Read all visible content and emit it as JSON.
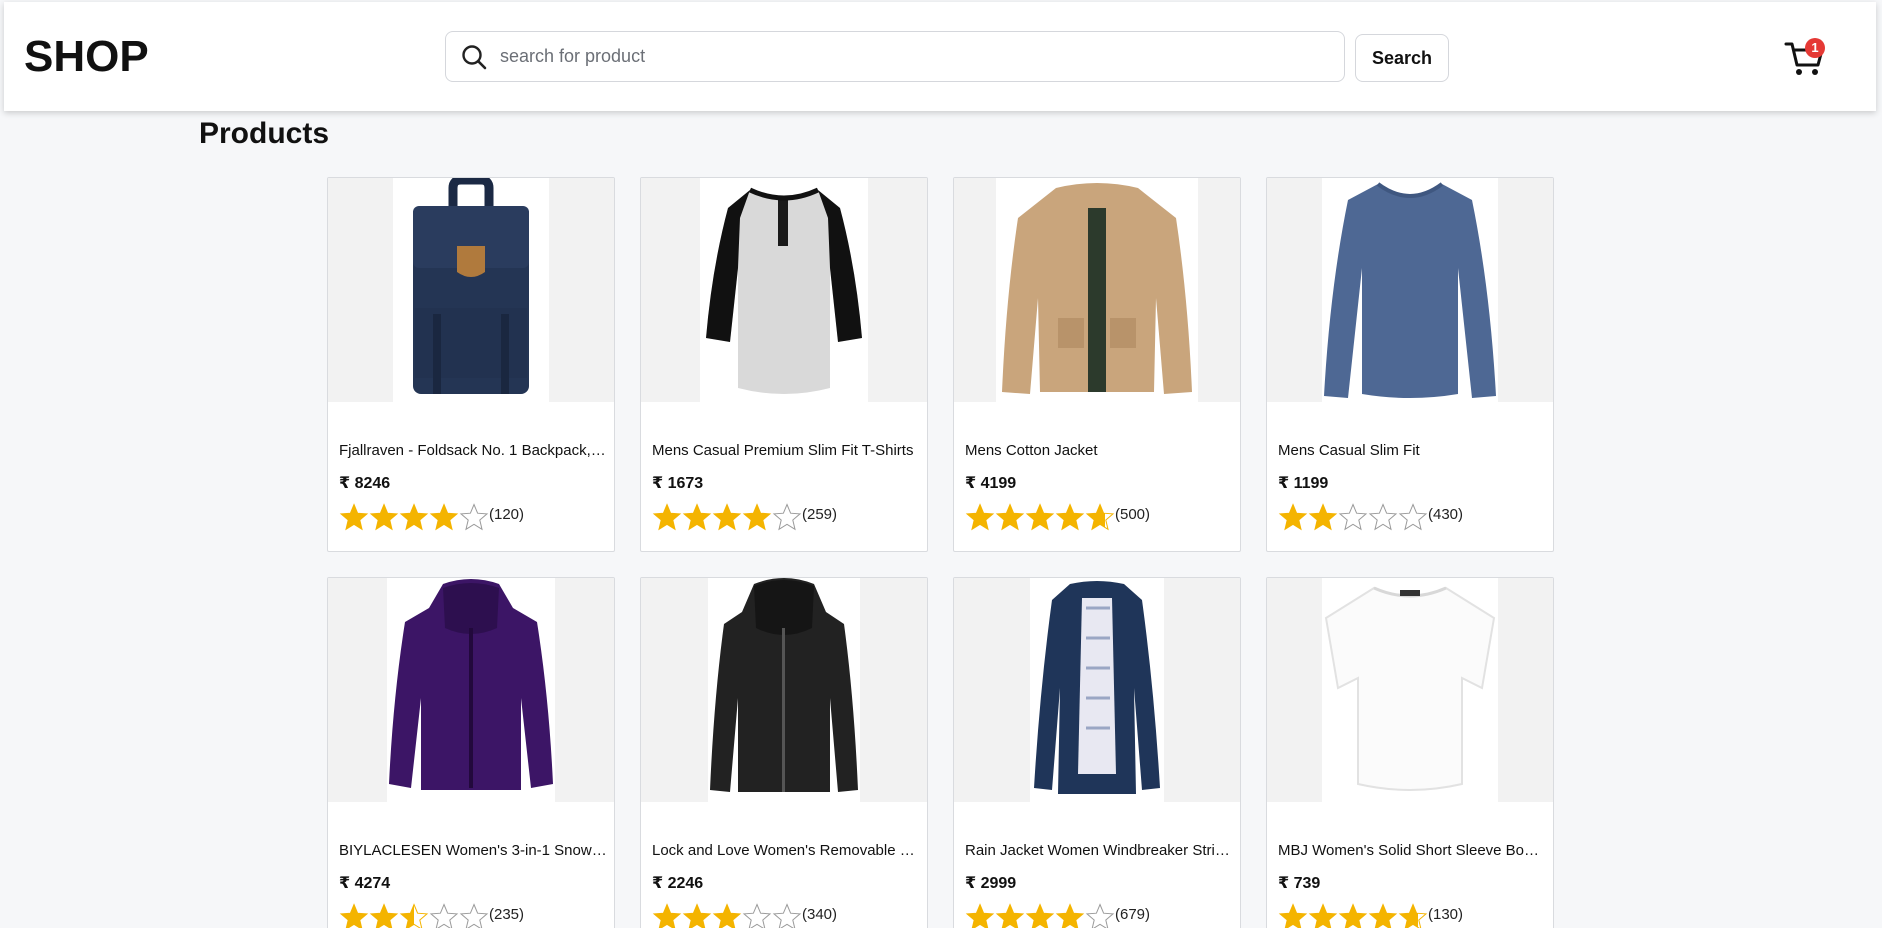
{
  "header": {
    "brand": "SHOP",
    "search": {
      "placeholder": "search for product",
      "value": "",
      "icon": "search-icon"
    },
    "search_button": "Search",
    "cart": {
      "icon": "cart-icon",
      "count": "1"
    }
  },
  "page": {
    "title": "Products"
  },
  "colors": {
    "star_filled": "#f4b400",
    "star_empty_stroke": "#9a9a9a",
    "badge": "#e53935"
  },
  "products": [
    {
      "name": "Fjallraven - Foldsack No. 1 Backpack, F...",
      "price": "₹ 8246",
      "rating": 4,
      "count": "(120)",
      "image": "backpack"
    },
    {
      "name": "Mens Casual Premium Slim Fit T-Shirts",
      "price": "₹ 1673",
      "rating": 4,
      "count": "(259)",
      "image": "raglan-tshirt"
    },
    {
      "name": "Mens Cotton Jacket",
      "price": "₹ 4199",
      "rating": 4.7,
      "count": "(500)",
      "image": "cotton-jacket"
    },
    {
      "name": "Mens Casual Slim Fit",
      "price": "₹ 1199",
      "rating": 2,
      "count": "(430)",
      "image": "longsleeve-shirt"
    },
    {
      "name": "BIYLACLESEN Women's 3-in-1 Snowb...",
      "price": "₹ 4274",
      "rating": 2.5,
      "count": "(235)",
      "image": "purple-jacket"
    },
    {
      "name": "Lock and Love Women's Removable H...",
      "price": "₹ 2246",
      "rating": 3,
      "count": "(340)",
      "image": "leather-jacket"
    },
    {
      "name": "Rain Jacket Women Windbreaker Strip...",
      "price": "₹ 2999",
      "rating": 4,
      "count": "(679)",
      "image": "rain-jacket"
    },
    {
      "name": "MBJ Women's Solid Short Sleeve Boat ...",
      "price": "₹ 739",
      "rating": 4.7,
      "count": "(130)",
      "image": "white-top"
    }
  ]
}
